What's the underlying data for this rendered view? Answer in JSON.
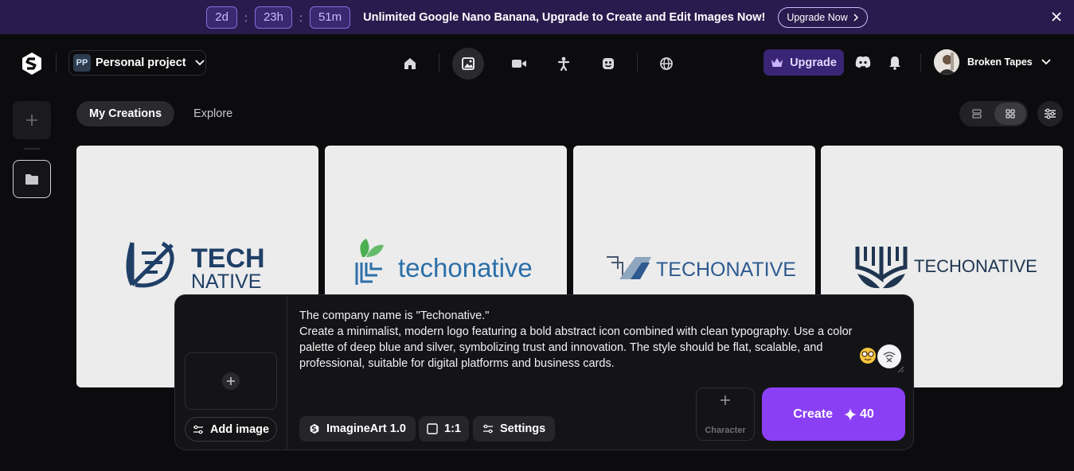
{
  "banner": {
    "days": "2d",
    "hours": "23h",
    "minutes": "51m",
    "separator": ":",
    "message": "Unlimited Google Nano Banana, Upgrade to Create and Edit Images Now!",
    "cta_label": "Upgrade Now",
    "close_icon": "close-icon"
  },
  "header": {
    "project_badge": "PP",
    "project_label": "Personal project",
    "nav_icons": [
      "home-icon",
      "image-icon",
      "video-icon",
      "character-icon",
      "mask-icon",
      "globe-icon"
    ],
    "active_nav": "image-icon",
    "upgrade_label": "Upgrade",
    "user_name": "Broken Tapes"
  },
  "tabs": [
    {
      "label": "My Creations",
      "active": true
    },
    {
      "label": "Explore",
      "active": false
    }
  ],
  "gallery": {
    "cards": [
      {
        "line1": "TECH",
        "line2": "NATIVE"
      },
      {
        "line1": "techonative"
      },
      {
        "line1": "TECHONATIVE"
      },
      {
        "line1": "TECHONATIVE"
      }
    ]
  },
  "prompt": {
    "text": "The company name is \"Techonative.\"\nCreate a minimalist, modern logo featuring a bold abstract icon combined with clean typography. Use a color palette of deep blue and silver, symbolizing trust and innovation. The style should be flat, scalable, and professional, suitable for digital platforms and business cards.",
    "add_image_label": "Add image",
    "model_label": "ImagineArt 1.0",
    "ratio_label": "1:1",
    "settings_label": "Settings",
    "character_label": "Character",
    "create_label": "Create",
    "credits": "40"
  },
  "colors": {
    "accent": "#8a3ff5",
    "banner_bg": "#2a1b4e",
    "upgrade_bg": "#3a2475",
    "logo_blue": "#1f3f66"
  }
}
